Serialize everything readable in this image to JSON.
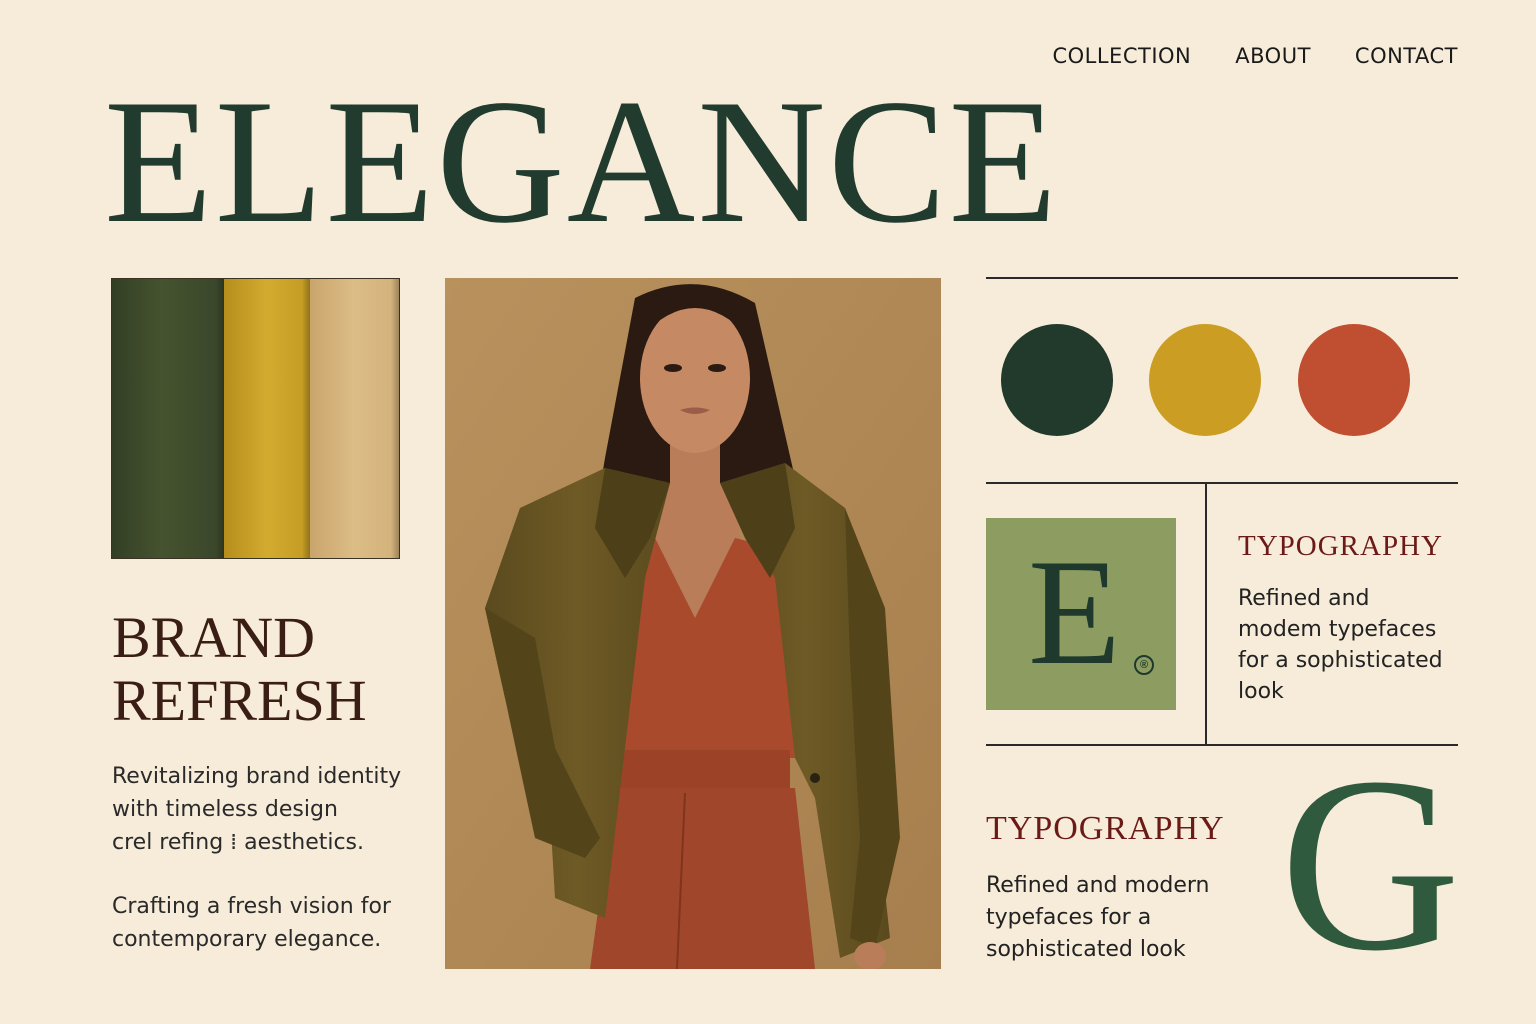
{
  "nav": {
    "items": [
      "COLLECTION",
      "ABOUT",
      "CONTACT"
    ]
  },
  "hero": {
    "title": "ELEGANCE"
  },
  "swatches": {
    "colors": [
      "#3e4a2c",
      "#c9a227",
      "#d6b47c"
    ]
  },
  "brand": {
    "title_line1": "BRAND",
    "title_line2": "REFRESH",
    "body1": [
      "Revitalizing brand identity",
      "with timeless design",
      "crel refing ⁞ aesthetics."
    ],
    "body2": [
      "Crafting a fresh vision for",
      "contemporary elegance."
    ]
  },
  "photo": {
    "alt": "Model wearing olive blazer and rust jumpsuit"
  },
  "palette": {
    "colors": [
      "#223a2c",
      "#cc9d23",
      "#c04e31"
    ]
  },
  "logo_mark": {
    "letter": "E",
    "registered": "®",
    "bg": "#8d9d62"
  },
  "typography_small": {
    "heading": "TYPOGRAPHY",
    "lines": [
      "Refined and",
      "modem typefaces",
      "for a sophisticated",
      "look"
    ]
  },
  "typography_large": {
    "heading": "TYPOGRAPHY",
    "lines": [
      "Refined and modern",
      "typefaces for a",
      "sophisticated look"
    ],
    "letter": "G"
  }
}
